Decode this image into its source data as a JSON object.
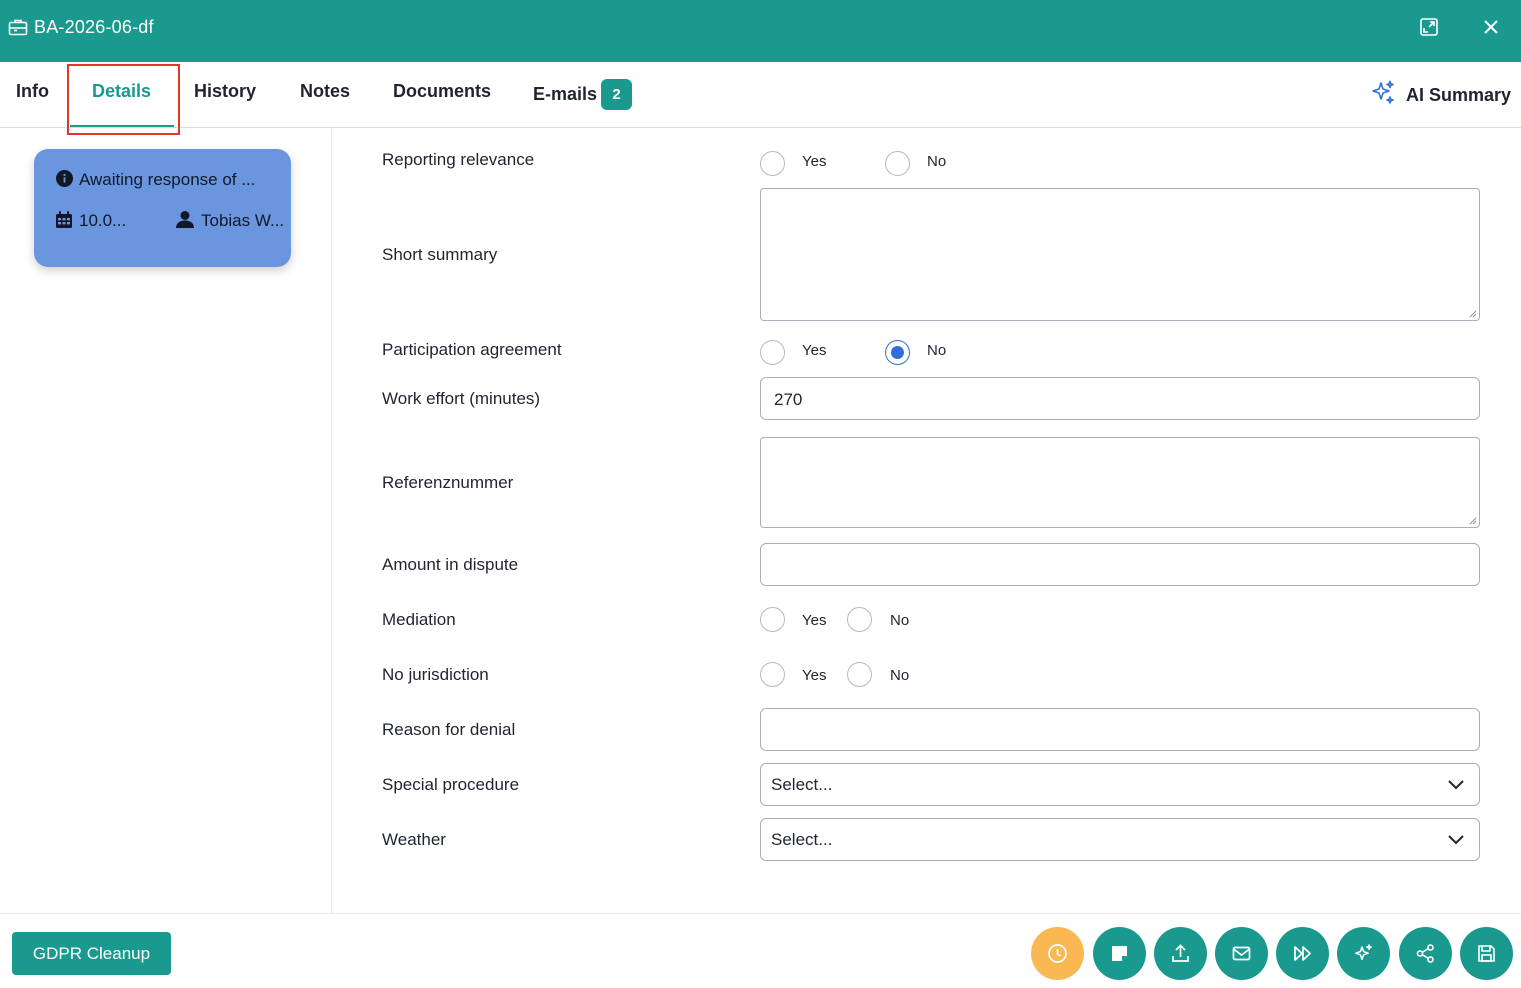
{
  "window": {
    "title": "BA-2026-06-df"
  },
  "tabs": [
    {
      "label": "Info",
      "active": false
    },
    {
      "label": "Details",
      "active": true
    },
    {
      "label": "History",
      "active": false
    },
    {
      "label": "Notes",
      "active": false
    },
    {
      "label": "Documents",
      "active": false
    },
    {
      "label": "E-mails",
      "active": false,
      "badge": "2"
    }
  ],
  "ai_summary": {
    "label": "AI Summary"
  },
  "status_card": {
    "status": "Awaiting response of ...",
    "date": "10.0...",
    "assignee": "Tobias W..."
  },
  "form": {
    "reporting_relevance": {
      "label": "Reporting relevance",
      "yes": "Yes",
      "no": "No",
      "selected": null
    },
    "short_summary": {
      "label": "Short summary",
      "value": ""
    },
    "participation_agreement": {
      "label": "Participation agreement",
      "yes": "Yes",
      "no": "No",
      "selected": "No"
    },
    "work_effort": {
      "label": "Work effort (minutes)",
      "value": "270"
    },
    "referenznummer": {
      "label": "Referenznummer",
      "value": ""
    },
    "amount_in_dispute": {
      "label": "Amount in dispute",
      "value": ""
    },
    "mediation": {
      "label": "Mediation",
      "yes": "Yes",
      "no": "No",
      "selected": null
    },
    "no_jurisdiction": {
      "label": "No jurisdiction",
      "yes": "Yes",
      "no": "No",
      "selected": null
    },
    "reason_for_denial": {
      "label": "Reason for denial",
      "value": ""
    },
    "special_procedure": {
      "label": "Special procedure",
      "value": "Select..."
    },
    "weather": {
      "label": "Weather",
      "value": "Select..."
    }
  },
  "footer": {
    "gdpr_label": "GDPR Cleanup",
    "actions": [
      "clock-icon",
      "sticky-note-icon",
      "upload-icon",
      "mail-icon",
      "fast-forward-icon",
      "sparkles-icon",
      "share-icon",
      "save-icon"
    ]
  },
  "colors": {
    "primary": "#1a9a8e",
    "card": "#6a96df",
    "accent_orange": "#f9b852",
    "radio_checked": "#2f6fd9",
    "highlight_box": "#e3372b"
  }
}
